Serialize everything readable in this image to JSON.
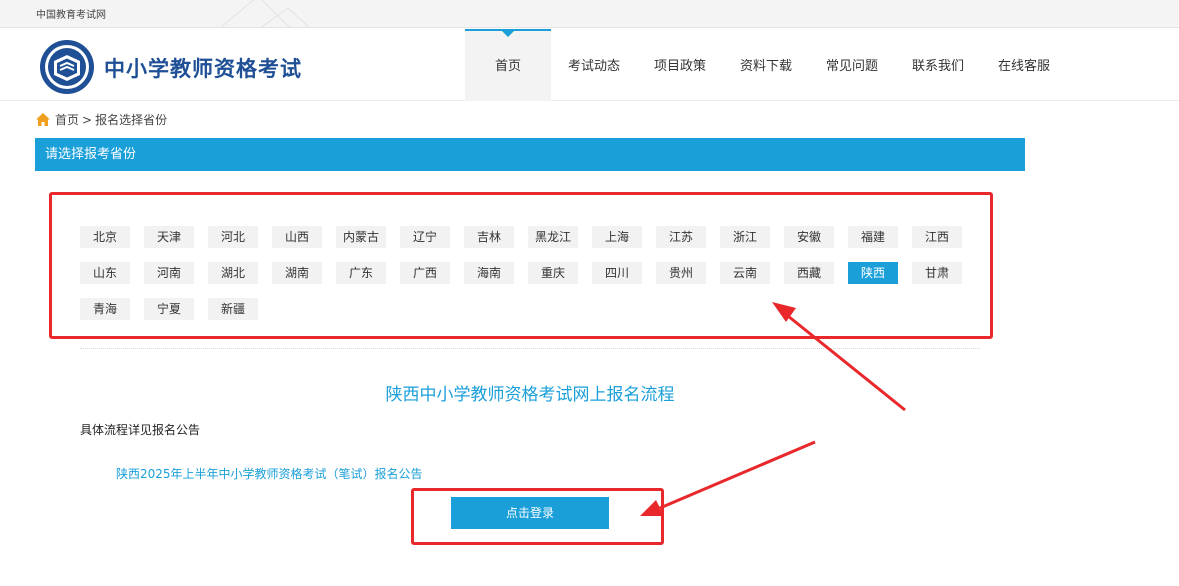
{
  "topbar": {
    "site_name": "中国教育考试网"
  },
  "header": {
    "brand_title": "中小学教师资格考试",
    "nav": [
      {
        "label": "首页",
        "active": true
      },
      {
        "label": "考试动态"
      },
      {
        "label": "项目政策"
      },
      {
        "label": "资料下载"
      },
      {
        "label": "常见问题"
      },
      {
        "label": "联系我们"
      },
      {
        "label": "在线客服"
      }
    ]
  },
  "breadcrumb": {
    "home": "首页",
    "separator": ">",
    "current": "报名选择省份"
  },
  "province_panel": {
    "title": "请选择报考省份",
    "rows": [
      [
        "北京",
        "天津",
        "河北",
        "山西",
        "内蒙古",
        "辽宁",
        "吉林",
        "黑龙江",
        "上海",
        "江苏",
        "浙江",
        "安徽",
        "福建",
        "江西"
      ],
      [
        "山东",
        "河南",
        "湖北",
        "湖南",
        "广东",
        "广西",
        "海南",
        "重庆",
        "四川",
        "贵州",
        "云南",
        "西藏",
        "陕西",
        "甘肃"
      ],
      [
        "青海",
        "宁夏",
        "新疆"
      ]
    ],
    "selected": "陕西"
  },
  "flow": {
    "title": "陕西中小学教师资格考试网上报名流程",
    "subtitle": "具体流程详见报名公告",
    "notice_link": "陕西2025年上半年中小学教师资格考试（笔试）报名公告",
    "login_button": "点击登录"
  },
  "colors": {
    "accent": "#1a9fd9",
    "brand": "#1f4f94",
    "highlight": "#e8282b"
  }
}
